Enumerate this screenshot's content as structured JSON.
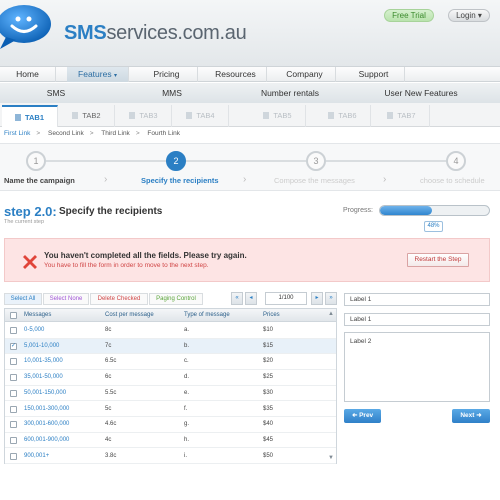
{
  "header": {
    "brand_bold": "SMS",
    "brand_rest": "services.com.au",
    "free_trial": "Free Trial",
    "login": "Login"
  },
  "nav": {
    "items": [
      {
        "label": "Home"
      },
      {
        "label": "Features"
      },
      {
        "label": "Pricing"
      },
      {
        "label": "Resources"
      },
      {
        "label": "Company"
      },
      {
        "label": "Support"
      }
    ],
    "active": "Features"
  },
  "subnav": {
    "items": [
      {
        "label": "SMS"
      },
      {
        "label": "MMS"
      },
      {
        "label": "Number rentals"
      },
      {
        "label": "User New Features"
      }
    ]
  },
  "tabs": [
    {
      "label": "TAB1"
    },
    {
      "label": "TAB2"
    },
    {
      "label": "TAB3"
    },
    {
      "label": "TAB4"
    },
    {
      "label": "TAB5"
    },
    {
      "label": "TAB6"
    },
    {
      "label": "TAB7"
    }
  ],
  "breadcrumb": {
    "items": [
      "First Link",
      "Second Link",
      "Third Link",
      "Fourth Link"
    ],
    "separator": ">"
  },
  "steps": [
    {
      "num": "1",
      "label": "Name the campaign"
    },
    {
      "num": "2",
      "label": "Specify the recipients"
    },
    {
      "num": "3",
      "label": "Compose the messages"
    },
    {
      "num": "4",
      "label": "choose to schedule"
    }
  ],
  "step_header": {
    "number": "step 2.0:",
    "title": "Specify the recipients",
    "subtitle": "The current step",
    "progress_label": "Progress:",
    "progress_value": 0.48,
    "progress_text": "48%"
  },
  "alert": {
    "title": "You haven't completed all the fields. Please try again.",
    "message": "You have to fill the form in order to move to the next step.",
    "button": "Restart the Step"
  },
  "toolbar": {
    "select_all": "Select All",
    "select_none": "Select None",
    "delete_checked": "Delete Checked",
    "paging_control": "Paging Control",
    "page": "1/100"
  },
  "table": {
    "columns": [
      "Messages",
      "Cost per message",
      "Type of message",
      "Prices"
    ],
    "rows": [
      {
        "messages": "0-5,000",
        "cost": "8c",
        "type": "a.",
        "price": "$10",
        "checked": false
      },
      {
        "messages": "5,001-10,000",
        "cost": "7c",
        "type": "b.",
        "price": "$15",
        "checked": true
      },
      {
        "messages": "10,001-35,000",
        "cost": "6.5c",
        "type": "c.",
        "price": "$20",
        "checked": false
      },
      {
        "messages": "35,001-50,000",
        "cost": "6c",
        "type": "d.",
        "price": "$25",
        "checked": false
      },
      {
        "messages": "50,001-150,000",
        "cost": "5.5c",
        "type": "e.",
        "price": "$30",
        "checked": false
      },
      {
        "messages": "150,001-300,000",
        "cost": "5c",
        "type": "f.",
        "price": "$35",
        "checked": false
      },
      {
        "messages": "300,001-600,000",
        "cost": "4.6c",
        "type": "g.",
        "price": "$40",
        "checked": false
      },
      {
        "messages": "600,001-900,000",
        "cost": "4c",
        "type": "h.",
        "price": "$45",
        "checked": false
      },
      {
        "messages": "900,001+",
        "cost": "3.8c",
        "type": "i.",
        "price": "$50",
        "checked": false
      }
    ]
  },
  "form": {
    "label1_a": "Label 1",
    "label1_b": "Label 1",
    "label2": "Label 2",
    "prev": "Prev",
    "next": "Next"
  },
  "colors": {
    "brand_blue": "#2b7fc4",
    "alert_bg": "#fde4e4",
    "alert_red": "#d04545",
    "trial_green": "#3b8a2d"
  }
}
